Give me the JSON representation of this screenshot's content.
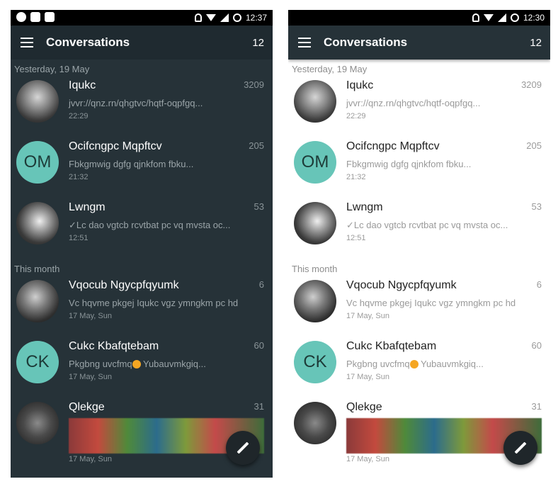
{
  "status": {
    "time_dark": "12:37",
    "time_light": "12:30"
  },
  "toolbar": {
    "title": "Conversations",
    "count": "12"
  },
  "sections": {
    "yesterday": "Yesterday, 19 May",
    "this_month": "This month"
  },
  "conversations": [
    {
      "name": "Iqukc",
      "snippet": "jvvr://qnz.rn/qhgtvc/hqtf-oqpfgq...",
      "time": "22:29",
      "count": "3209",
      "avatar": "photo"
    },
    {
      "name": "Ocifcngpc Mqpftcv",
      "snippet": "Fbkgmwig dgfg qjnkfom fbku...",
      "time": "21:32",
      "count": "205",
      "avatar": "OM"
    },
    {
      "name": "Lwngm",
      "snippet": "✓Lc dao vgtcb rcvtbat pc vq mvsta oc...",
      "time": "12:51",
      "count": "53",
      "avatar": "photo"
    },
    {
      "name": "Vqocub Ngycpfqyumk",
      "snippet": "Vc hqvme pkgej Iqukc vgz ymngkm pc hd",
      "time": "17 May, Sun",
      "count": "6",
      "avatar": "photo"
    },
    {
      "name": "Cukc Kbafqtebam",
      "snippet_a": "Pkgbng uvcfmq",
      "snippet_b": " Yubauvmkgiq...",
      "time": "17 May, Sun",
      "count": "60",
      "avatar": "CK"
    },
    {
      "name": "Qlekge",
      "time": "17 May, Sun",
      "count": "31",
      "avatar": "photo"
    }
  ]
}
